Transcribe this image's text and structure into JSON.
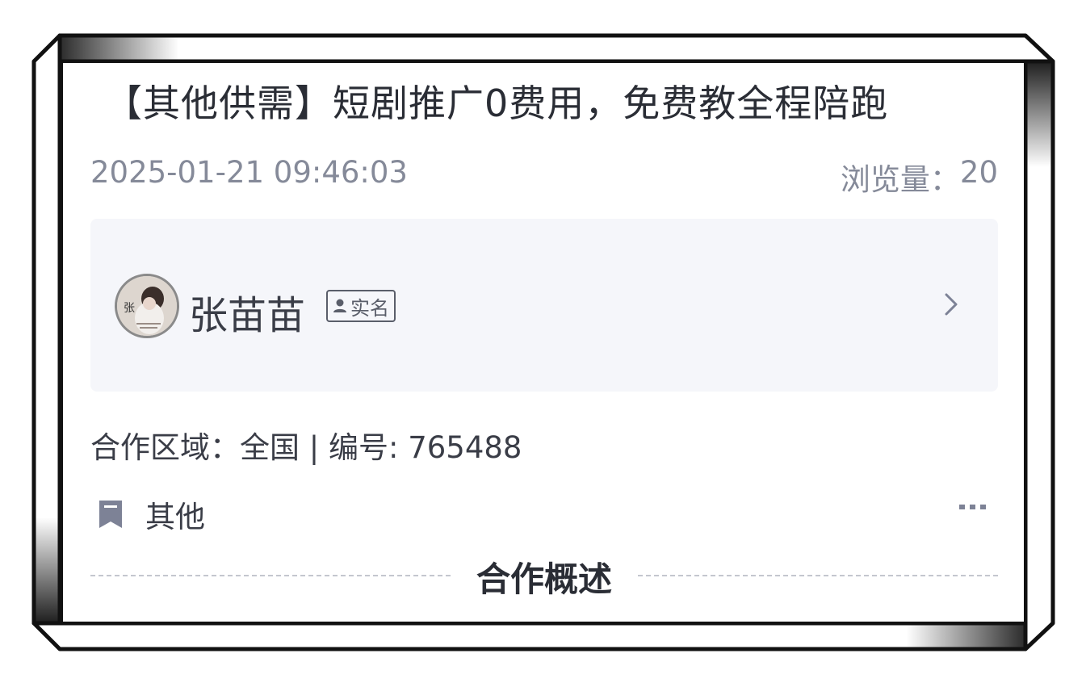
{
  "post": {
    "title": "【其他供需】短剧推广0费用，免费教全程陪跑",
    "datetime": "2025-01-21 09:46:03",
    "views_label": "浏览量：",
    "views_count": "20"
  },
  "publisher": {
    "name": "张苗苗",
    "verified_label": "实名",
    "avatar_glyph": "张"
  },
  "details": {
    "region_line": "合作区域：全国 | 编号: 765488",
    "category": "其他"
  },
  "section": {
    "title": "合作概述"
  },
  "icons": {
    "bookmark": "bookmark-icon",
    "more": "more-icon",
    "chevron": "chevron-right-icon",
    "person": "person-icon"
  },
  "colors": {
    "text_primary": "#2a2d35",
    "text_secondary": "#858a99",
    "card_bg": "#f5f6fa",
    "icon_muted": "#7d8296"
  }
}
